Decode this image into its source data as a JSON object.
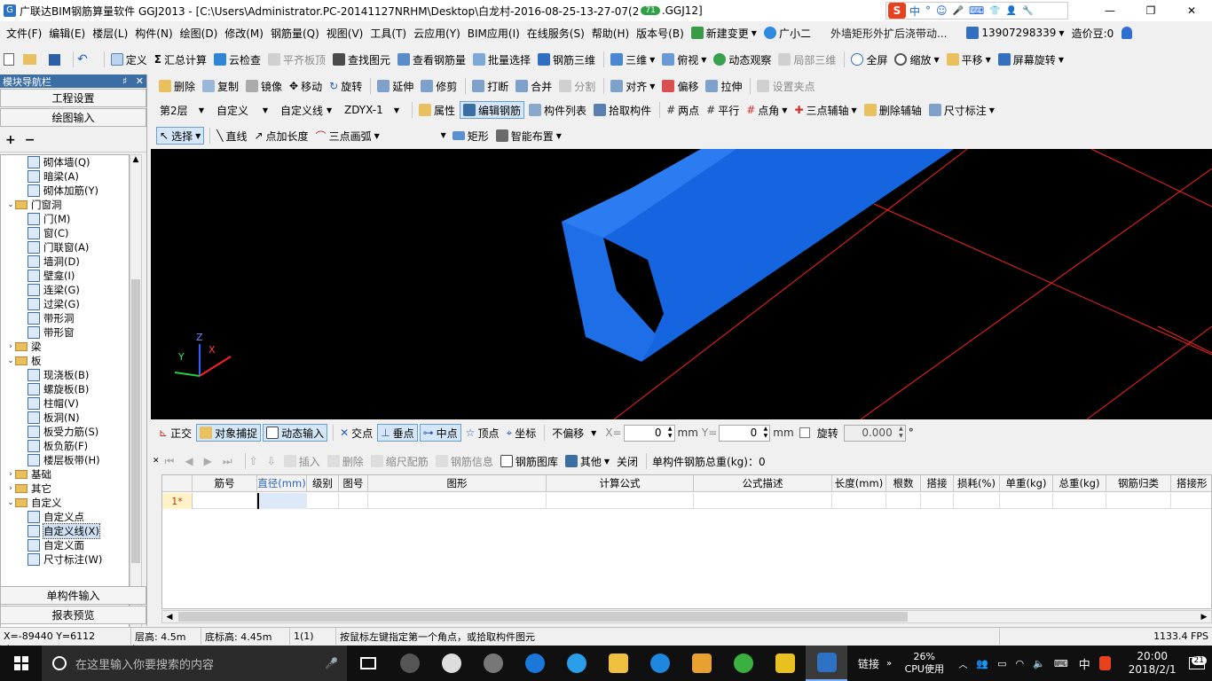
{
  "window": {
    "title": "广联达BIM钢筋算量软件 GGJ2013 - [C:\\Users\\Administrator.PC-20141127NRHM\\Desktop\\白龙村-2016-08-25-13-27-07(2",
    "title_tail": ".GGJ12]",
    "badge": "71",
    "controls": {
      "min": "—",
      "max": "❐",
      "close": "✕"
    }
  },
  "ime": {
    "logo": "S",
    "items": [
      "中",
      "°",
      "☺",
      "🎤",
      "⌨",
      "👕",
      "👤",
      "🔧"
    ]
  },
  "menu": {
    "items": [
      "文件(F)",
      "编辑(E)",
      "楼层(L)",
      "构件(N)",
      "绘图(D)",
      "修改(M)",
      "钢筋量(Q)",
      "视图(V)",
      "工具(T)",
      "云应用(Y)",
      "BIM应用(I)",
      "在线服务(S)",
      "帮助(H)",
      "版本号(B)"
    ],
    "new_change": "新建变更",
    "assistant": "广小二",
    "notice": "外墙矩形外扩后浇带动...",
    "phone": "13907298339",
    "price": "造价豆:0"
  },
  "toolbar1": {
    "items": [
      "定义",
      "汇总计算",
      "云检查",
      "平齐板顶",
      "查找图元",
      "查看钢筋量",
      "批量选择",
      "钢筋三维",
      "三维",
      "俯视",
      "动态观察",
      "局部三维",
      "全屏",
      "缩放",
      "平移",
      "屏幕旋转"
    ]
  },
  "toolbar2": {
    "items": [
      "删除",
      "复制",
      "镜像",
      "移动",
      "旋转",
      "延伸",
      "修剪",
      "打断",
      "合并",
      "分割",
      "对齐",
      "偏移",
      "拉伸",
      "设置夹点"
    ]
  },
  "toolbar3": {
    "floor": "第2层",
    "cat": "自定义",
    "type": "自定义线",
    "code": "ZDYX-1",
    "items": [
      "属性",
      "编辑钢筋",
      "构件列表",
      "拾取构件",
      "两点",
      "平行",
      "点角",
      "三点辅轴",
      "删除辅轴",
      "尺寸标注"
    ]
  },
  "toolbar4": {
    "items": [
      "选择",
      "直线",
      "点加长度",
      "三点画弧",
      "矩形",
      "智能布置"
    ]
  },
  "sidebar": {
    "title": "模块导航栏",
    "pin": "♯",
    "close": "✕",
    "project_settings": "工程设置",
    "drawing_input": "绘图输入",
    "single_input": "单构件输入",
    "report_preview": "报表预览",
    "tree": [
      {
        "label": "砌体墙(Q)",
        "lvl": 2
      },
      {
        "label": "暗梁(A)",
        "lvl": 2
      },
      {
        "label": "砌体加筋(Y)",
        "lvl": 2
      },
      {
        "label": "门窗洞",
        "lvl": 1,
        "folder": true,
        "open": true
      },
      {
        "label": "门(M)",
        "lvl": 2
      },
      {
        "label": "窗(C)",
        "lvl": 2
      },
      {
        "label": "门联窗(A)",
        "lvl": 2
      },
      {
        "label": "墙洞(D)",
        "lvl": 2
      },
      {
        "label": "壁龛(I)",
        "lvl": 2
      },
      {
        "label": "连梁(G)",
        "lvl": 2
      },
      {
        "label": "过梁(G)",
        "lvl": 2
      },
      {
        "label": "带形洞",
        "lvl": 2
      },
      {
        "label": "带形窗",
        "lvl": 2
      },
      {
        "label": "梁",
        "lvl": 1,
        "folder": true,
        "open": false
      },
      {
        "label": "板",
        "lvl": 1,
        "folder": true,
        "open": true
      },
      {
        "label": "现浇板(B)",
        "lvl": 2
      },
      {
        "label": "螺旋板(B)",
        "lvl": 2
      },
      {
        "label": "柱帽(V)",
        "lvl": 2
      },
      {
        "label": "板洞(N)",
        "lvl": 2
      },
      {
        "label": "板受力筋(S)",
        "lvl": 2
      },
      {
        "label": "板负筋(F)",
        "lvl": 2
      },
      {
        "label": "楼层板带(H)",
        "lvl": 2
      },
      {
        "label": "基础",
        "lvl": 1,
        "folder": true,
        "open": false
      },
      {
        "label": "其它",
        "lvl": 1,
        "folder": true,
        "open": false
      },
      {
        "label": "自定义",
        "lvl": 1,
        "folder": true,
        "open": true
      },
      {
        "label": "自定义点",
        "lvl": 2
      },
      {
        "label": "自定义线(X)",
        "lvl": 2,
        "selected": true
      },
      {
        "label": "自定义面",
        "lvl": 2
      },
      {
        "label": "尺寸标注(W)",
        "lvl": 2
      }
    ]
  },
  "snapbar": {
    "items": [
      "正交",
      "对象捕捉",
      "动态输入",
      "交点",
      "垂点",
      "中点",
      "顶点",
      "坐标"
    ],
    "offset": "不偏移",
    "x_label": "X=",
    "x_value": "0",
    "y_label": "Y=",
    "y_value": "0",
    "unit": "mm",
    "rotate_label": "旋转",
    "rotate_value": "0.000",
    "degree": "°"
  },
  "rebarbar": {
    "items": [
      "插入",
      "删除",
      "缩尺配筋",
      "钢筋信息",
      "钢筋图库",
      "其他",
      "关闭"
    ],
    "total": "单构件钢筋总重(kg)：0"
  },
  "table": {
    "headers": [
      "筋号",
      "直径(mm)",
      "级别",
      "图号",
      "图形",
      "计算公式",
      "公式描述",
      "长度(mm)",
      "根数",
      "搭接",
      "损耗(%)",
      "单重(kg)",
      "总重(kg)",
      "钢筋归类",
      "搭接形"
    ],
    "row_label": "1*"
  },
  "status": {
    "coords": "X=-89440 Y=6112",
    "floor_height": "层高: 4.5m",
    "base_height": "底标高: 4.45m",
    "count": "1(1)",
    "hint": "按鼠标左键指定第一个角点，或拾取构件图元",
    "fps": "1133.4 FPS"
  },
  "taskbar": {
    "search": "在这里输入你要搜索的内容",
    "link": "链接",
    "cpu_pct": "26%",
    "cpu_label": "CPU使用",
    "ime": "中",
    "time": "20:00",
    "date": "2018/2/1",
    "notif": "21"
  },
  "axes": {
    "x": "X",
    "y": "Y",
    "z": "Z"
  },
  "colors": {
    "accent": "#3c6ea6",
    "beam": "#1e6ee8",
    "grid": "#ff2020"
  }
}
